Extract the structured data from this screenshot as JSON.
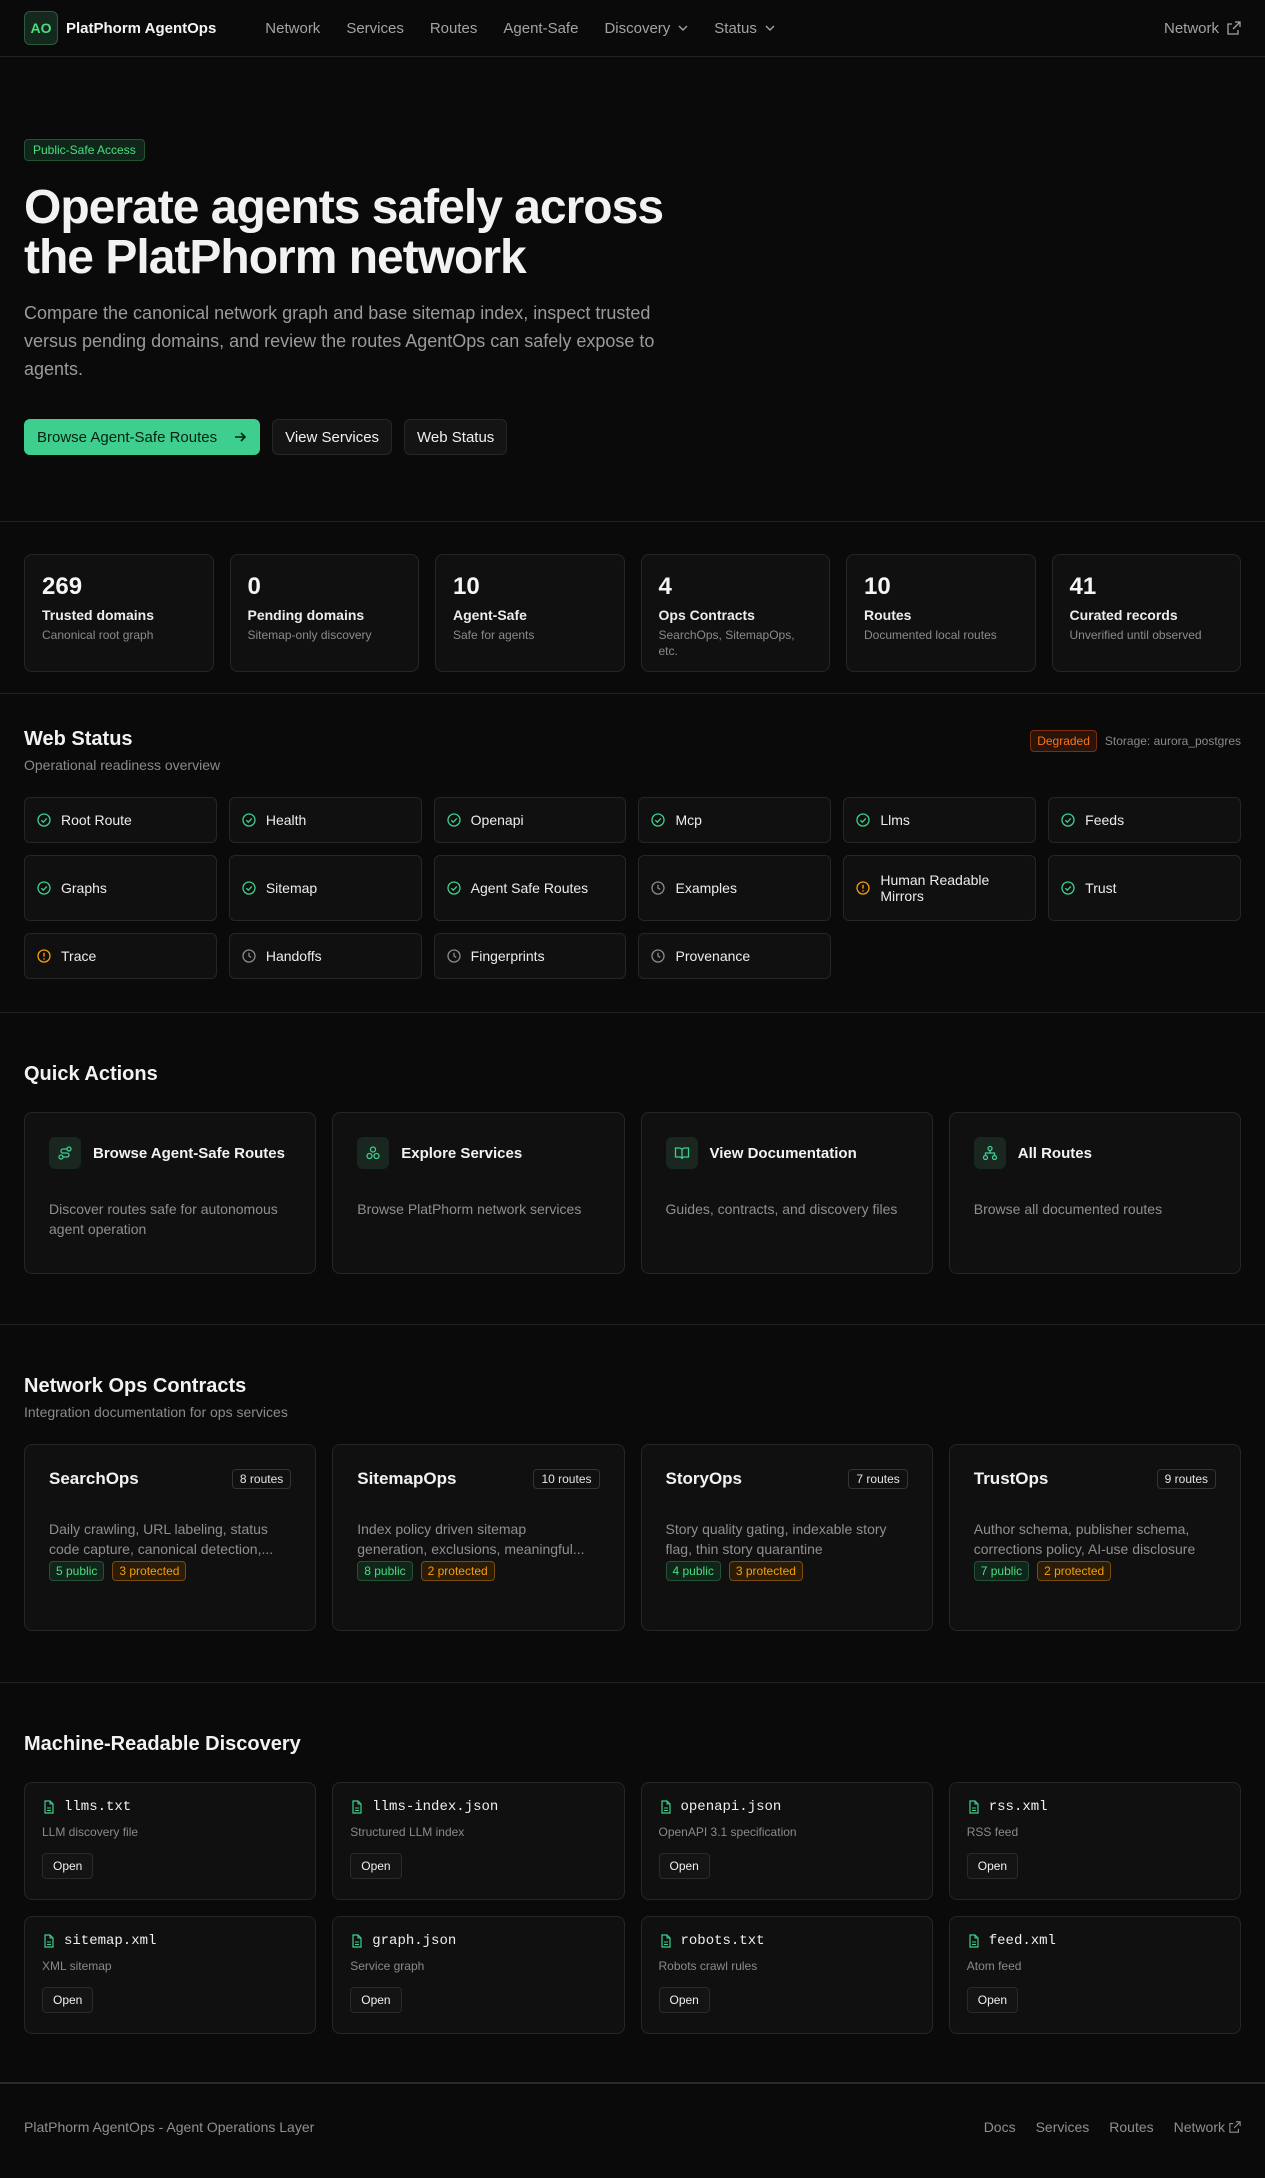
{
  "nav": {
    "logo": "AO",
    "brand": "PlatPhorm AgentOps",
    "links": [
      "Network",
      "Services",
      "Routes",
      "Agent-Safe",
      "Discovery",
      "Status"
    ],
    "right_link": "Network"
  },
  "hero": {
    "badge": "Public-Safe Access",
    "title": "Operate agents safely across the PlatPhorm network",
    "lead": "Compare the canonical network graph and base sitemap index, inspect trusted versus pending domains, and review the routes AgentOps can safely expose to agents.",
    "primary_button": "Browse Agent-Safe Routes",
    "secondary_button": "View Services",
    "tertiary_button": "Web Status"
  },
  "stats": [
    {
      "value": "269",
      "label": "Trusted domains",
      "desc": "Canonical root graph"
    },
    {
      "value": "0",
      "label": "Pending domains",
      "desc": "Sitemap-only discovery"
    },
    {
      "value": "10",
      "label": "Agent-Safe",
      "desc": "Safe for agents"
    },
    {
      "value": "4",
      "label": "Ops Contracts",
      "desc": "SearchOps, SitemapOps, etc."
    },
    {
      "value": "10",
      "label": "Routes",
      "desc": "Documented local routes"
    },
    {
      "value": "41",
      "label": "Curated records",
      "desc": "Unverified until observed"
    }
  ],
  "status": {
    "title": "Web Status",
    "subtitle": "Operational readiness overview",
    "badge": "Degraded",
    "storage": "Storage: aurora_postgres",
    "colors": {
      "ok": "#3ecf8e",
      "warn": "#f59e0b",
      "pending": "#8a8a8a"
    },
    "items": [
      {
        "label": "Root Route",
        "state": "ok"
      },
      {
        "label": "Health",
        "state": "ok"
      },
      {
        "label": "Openapi",
        "state": "ok"
      },
      {
        "label": "Mcp",
        "state": "ok"
      },
      {
        "label": "Llms",
        "state": "ok"
      },
      {
        "label": "Feeds",
        "state": "ok"
      },
      {
        "label": "Graphs",
        "state": "ok"
      },
      {
        "label": "Sitemap",
        "state": "ok"
      },
      {
        "label": "Agent Safe Routes",
        "state": "ok"
      },
      {
        "label": "Examples",
        "state": "pending"
      },
      {
        "label": "Human Readable Mirrors",
        "state": "warn"
      },
      {
        "label": "Trust",
        "state": "ok"
      },
      {
        "label": "Trace",
        "state": "warn"
      },
      {
        "label": "Handoffs",
        "state": "pending"
      },
      {
        "label": "Fingerprints",
        "state": "pending"
      },
      {
        "label": "Provenance",
        "state": "pending"
      }
    ]
  },
  "quick": {
    "title": "Quick Actions",
    "cards": [
      {
        "title": "Browse Agent-Safe Routes",
        "desc": "Discover routes safe for autonomous agent operation",
        "icon": "route-icon"
      },
      {
        "title": "Explore Services",
        "desc": "Browse PlatPhorm network services",
        "icon": "boxes-icon"
      },
      {
        "title": "View Documentation",
        "desc": "Guides, contracts, and discovery files",
        "icon": "book-icon"
      },
      {
        "title": "All Routes",
        "desc": "Browse all documented routes",
        "icon": "network-icon"
      }
    ]
  },
  "contracts": {
    "title": "Network Ops Contracts",
    "subtitle": "Integration documentation for ops services",
    "cards": [
      {
        "title": "SearchOps",
        "routes": "8 routes",
        "desc": "Daily crawling, URL labeling, status code capture, canonical detection,...",
        "public": "5 public",
        "protected": "3 protected"
      },
      {
        "title": "SitemapOps",
        "routes": "10 routes",
        "desc": "Index policy driven sitemap generation, exclusions, meaningful...",
        "public": "8 public",
        "protected": "2 protected"
      },
      {
        "title": "StoryOps",
        "routes": "7 routes",
        "desc": "Story quality gating, indexable story flag, thin story quarantine",
        "public": "4 public",
        "protected": "3 protected"
      },
      {
        "title": "TrustOps",
        "routes": "9 routes",
        "desc": "Author schema, publisher schema, corrections policy, AI-use disclosure",
        "public": "7 public",
        "protected": "2 protected"
      }
    ]
  },
  "discovery": {
    "title": "Machine-Readable Discovery",
    "open_label": "Open",
    "files": [
      {
        "name": "llms.txt",
        "desc": "LLM discovery file"
      },
      {
        "name": "llms-index.json",
        "desc": "Structured LLM index"
      },
      {
        "name": "openapi.json",
        "desc": "OpenAPI 3.1 specification"
      },
      {
        "name": "rss.xml",
        "desc": "RSS feed"
      },
      {
        "name": "sitemap.xml",
        "desc": "XML sitemap"
      },
      {
        "name": "graph.json",
        "desc": "Service graph"
      },
      {
        "name": "robots.txt",
        "desc": "Robots crawl rules"
      },
      {
        "name": "feed.xml",
        "desc": "Atom feed"
      }
    ]
  },
  "footer": {
    "text": "PlatPhorm AgentOps - Agent Operations Layer",
    "links": [
      "Docs",
      "Services",
      "Routes",
      "Network"
    ]
  }
}
